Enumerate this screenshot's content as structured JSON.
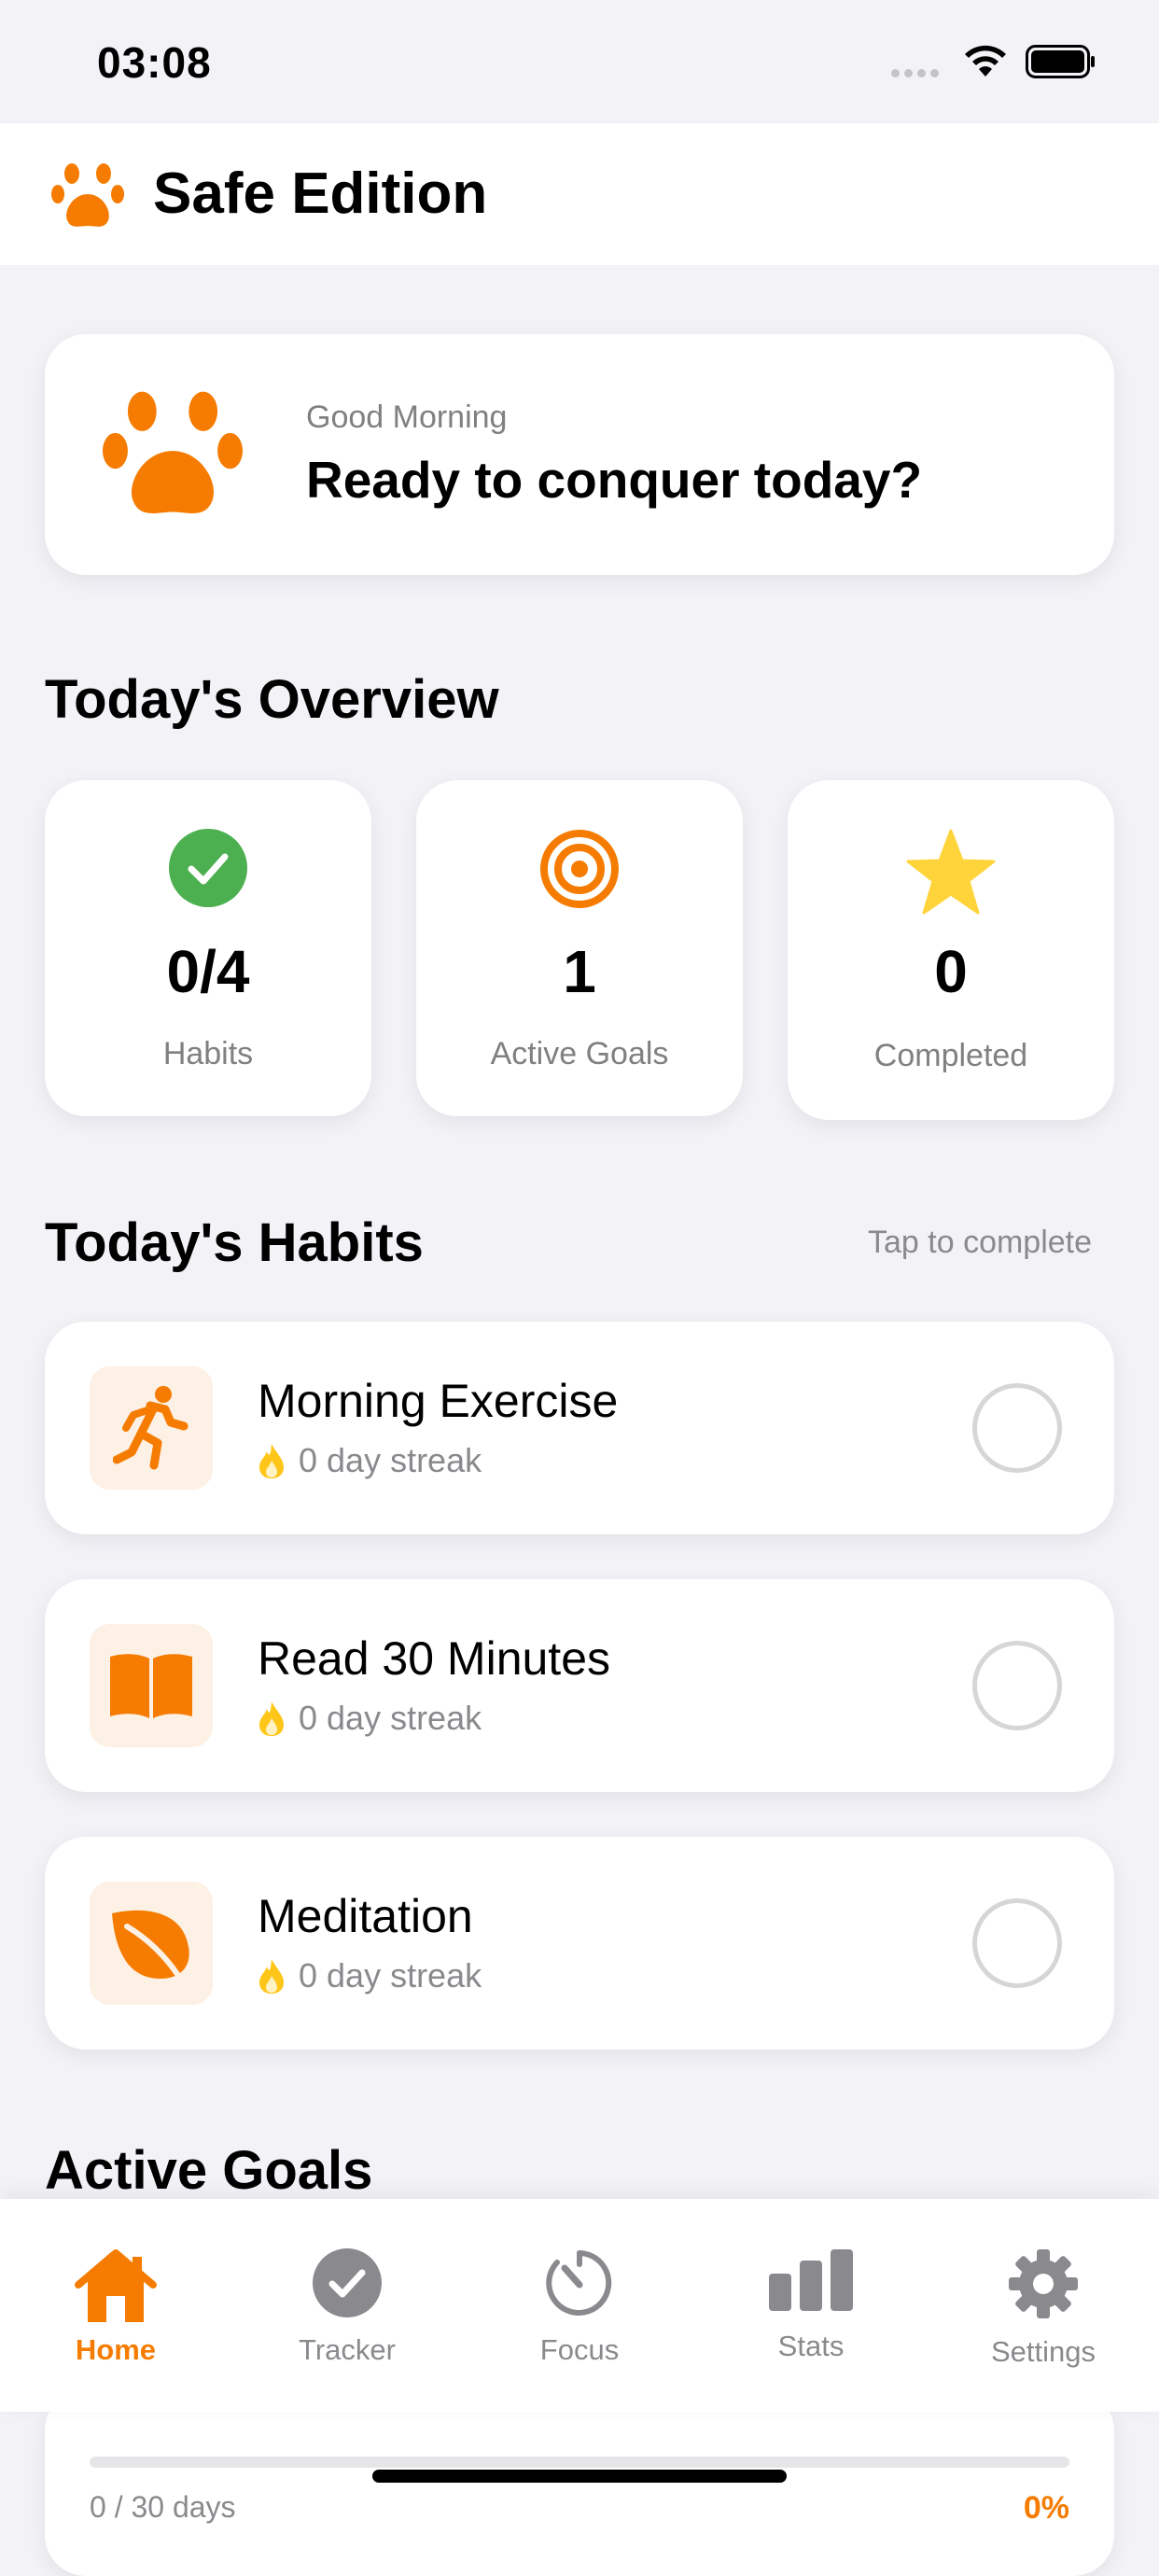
{
  "status_bar": {
    "time": "03:08"
  },
  "header": {
    "title": "Safe Edition",
    "logo_icon": "paw-icon"
  },
  "greeting": {
    "subtitle": "Good Morning",
    "message": "Ready to conquer today?"
  },
  "overview": {
    "title": "Today's Overview",
    "stats": [
      {
        "value": "0/4",
        "label": "Habits",
        "icon": "check-circle-icon",
        "color": "#4caf50"
      },
      {
        "value": "1",
        "label": "Active Goals",
        "icon": "target-icon",
        "color": "#f57c00"
      },
      {
        "value": "0",
        "label": "Completed",
        "icon": "star-icon",
        "color": "#ffd43b"
      }
    ]
  },
  "habits": {
    "title": "Today's Habits",
    "hint": "Tap to complete",
    "items": [
      {
        "name": "Morning Exercise",
        "streak": "0 day streak",
        "icon": "running-icon"
      },
      {
        "name": "Read 30 Minutes",
        "streak": "0 day streak",
        "icon": "book-icon"
      },
      {
        "name": "Meditation",
        "streak": "0 day streak",
        "icon": "leaf-icon"
      }
    ]
  },
  "goals": {
    "title": "Active Goals",
    "first": {
      "days": "0 / 30 days",
      "percent": "0%",
      "progress": 0
    }
  },
  "tabs": [
    {
      "label": "Home",
      "icon": "home-icon",
      "active": true
    },
    {
      "label": "Tracker",
      "icon": "check-badge-icon",
      "active": false
    },
    {
      "label": "Focus",
      "icon": "timer-icon",
      "active": false
    },
    {
      "label": "Stats",
      "icon": "bar-chart-icon",
      "active": false
    },
    {
      "label": "Settings",
      "icon": "gear-icon",
      "active": false
    }
  ],
  "colors": {
    "accent": "#f57c00",
    "success": "#4caf50",
    "star": "#ffd43b",
    "flame": "#ffc61a"
  }
}
